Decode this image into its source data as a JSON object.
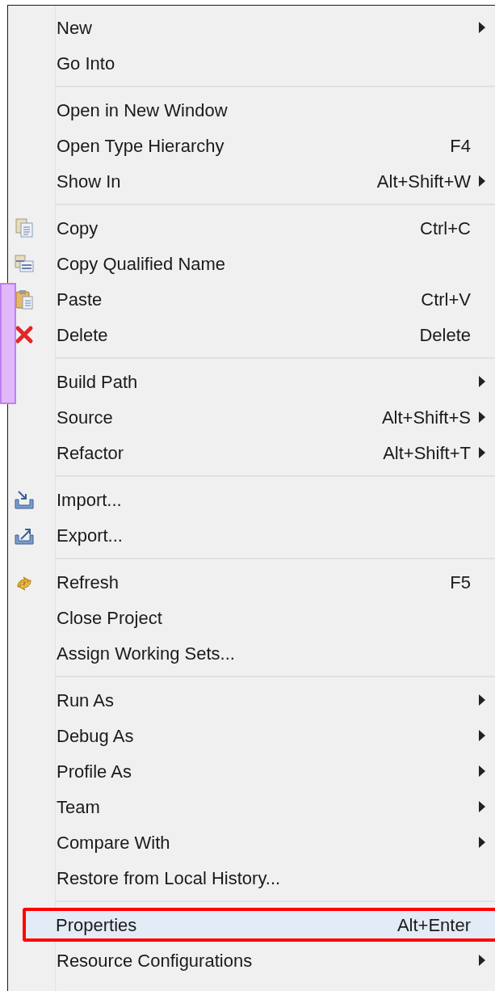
{
  "menu": {
    "groups": [
      {
        "items": [
          {
            "label": "New",
            "submenu": true,
            "selected": false
          },
          {
            "label": "Go Into",
            "submenu": false,
            "selected": false
          }
        ]
      },
      {
        "items": [
          {
            "label": "Open in New Window",
            "submenu": false,
            "selected": false
          },
          {
            "label": "Open Type Hierarchy",
            "shortcut": "F4",
            "submenu": false,
            "selected": false
          },
          {
            "label": "Show In",
            "shortcut": "Alt+Shift+W",
            "submenu": true,
            "selected": false
          }
        ]
      },
      {
        "items": [
          {
            "label": "Copy",
            "shortcut": "Ctrl+C",
            "submenu": false,
            "selected": false,
            "kind": "copy"
          },
          {
            "label": "Copy Qualified Name",
            "submenu": false,
            "selected": false,
            "kind": "copy-name"
          },
          {
            "label": "Paste",
            "shortcut": "Ctrl+V",
            "submenu": false,
            "selected": false,
            "kind": "paste"
          },
          {
            "label": "Delete",
            "shortcut": "Delete",
            "submenu": false,
            "selected": false,
            "kind": "delete"
          }
        ]
      },
      {
        "items": [
          {
            "label": "Build Path",
            "submenu": true,
            "selected": false
          },
          {
            "label": "Source",
            "shortcut": "Alt+Shift+S",
            "submenu": true,
            "selected": false
          },
          {
            "label": "Refactor",
            "shortcut": "Alt+Shift+T",
            "submenu": true,
            "selected": false
          }
        ]
      },
      {
        "items": [
          {
            "label": "Import...",
            "submenu": false,
            "selected": false,
            "kind": "import"
          },
          {
            "label": "Export...",
            "submenu": false,
            "selected": false,
            "kind": "export"
          }
        ]
      },
      {
        "items": [
          {
            "label": "Refresh",
            "shortcut": "F5",
            "submenu": false,
            "selected": false,
            "kind": "refresh"
          },
          {
            "label": "Close Project",
            "submenu": false,
            "selected": false
          },
          {
            "label": "Assign Working Sets...",
            "submenu": false,
            "selected": false
          }
        ]
      },
      {
        "items": [
          {
            "label": "Run As",
            "submenu": true,
            "selected": false
          },
          {
            "label": "Debug As",
            "submenu": true,
            "selected": false
          },
          {
            "label": "Profile As",
            "submenu": true,
            "selected": false
          },
          {
            "label": "Team",
            "submenu": true,
            "selected": false
          },
          {
            "label": "Compare With",
            "submenu": true,
            "selected": false
          },
          {
            "label": "Restore from Local History...",
            "submenu": false,
            "selected": false
          }
        ]
      },
      {
        "items": [
          {
            "label": "Properties",
            "shortcut": "Alt+Enter",
            "submenu": false,
            "selected": true
          },
          {
            "label": "Resource Configurations",
            "submenu": true,
            "selected": false
          }
        ]
      }
    ]
  }
}
